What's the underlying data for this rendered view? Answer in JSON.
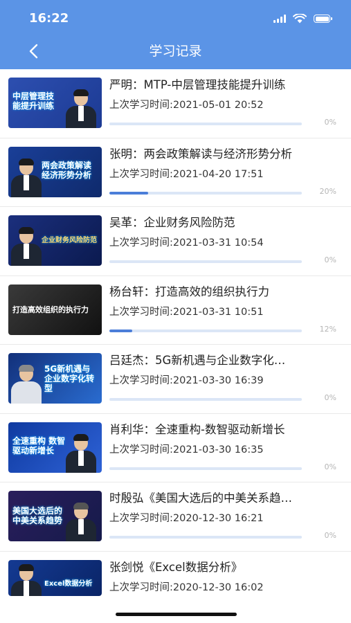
{
  "status_bar": {
    "time": "16:22"
  },
  "header": {
    "title": "学习记录"
  },
  "colors": {
    "header": "#5b94e6",
    "progress": "#4b7ed9",
    "track": "#dbe6f6"
  },
  "records": [
    {
      "title": "严明：MTP-中层管理技能提升训练",
      "time": "上次学习时间:2021-05-01 20:52",
      "progress_percent": 0,
      "progress_label": "0%",
      "thumb_text": "中层管理技能提升训练"
    },
    {
      "title": "张明：两会政策解读与经济形势分析",
      "time": "上次学习时间:2021-04-20 17:51",
      "progress_percent": 20,
      "progress_label": "20%",
      "thumb_text": "两会政策解读 经济形势分析"
    },
    {
      "title": "吴革：企业财务风险防范",
      "time": "上次学习时间:2021-03-31 10:54",
      "progress_percent": 0,
      "progress_label": "0%",
      "thumb_text": "企业财务风险防范"
    },
    {
      "title": "杨台轩：打造高效的组织执行力",
      "time": "上次学习时间:2021-03-31 10:51",
      "progress_percent": 12,
      "progress_label": "12%",
      "thumb_text": "打造高效组织的执行力"
    },
    {
      "title": "吕廷杰：5G新机遇与企业数字化…",
      "time": "上次学习时间:2021-03-30 16:39",
      "progress_percent": 0,
      "progress_label": "0%",
      "thumb_text": "5G新机遇与 企业数字化转型"
    },
    {
      "title": "肖利华：全速重构-数智驱动新增长",
      "time": "上次学习时间:2021-03-30 16:35",
      "progress_percent": 0,
      "progress_label": "0%",
      "thumb_text": "全速重构 数智驱动新增长"
    },
    {
      "title": "时殷弘《美国大选后的中美关系趋…",
      "time": "上次学习时间:2020-12-30 16:21",
      "progress_percent": 0,
      "progress_label": "0%",
      "thumb_text": "美国大选后的 中美关系趋势"
    },
    {
      "title": "张剑悦《Excel数据分析》",
      "time": "上次学习时间:2020-12-30 16:02",
      "progress_percent": 0,
      "progress_label": "",
      "thumb_text": "Excel数据分析"
    }
  ]
}
